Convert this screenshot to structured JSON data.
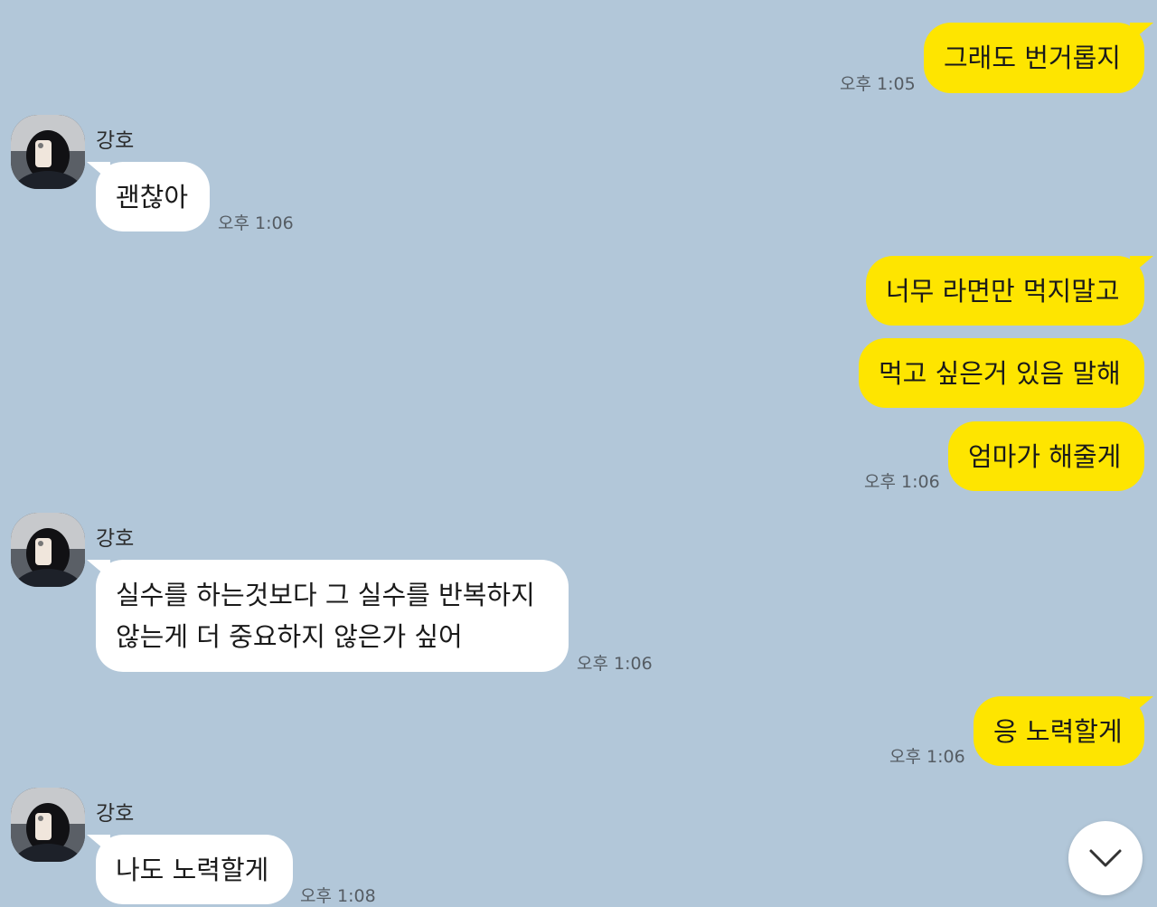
{
  "contact": {
    "name": "강호"
  },
  "messages": [
    {
      "from": "me",
      "text": "그래도 번거롭지",
      "time": "오후 1:05"
    },
    {
      "from": "them",
      "text": "괜찮아",
      "time": "오후 1:06"
    },
    {
      "from": "me",
      "text": "너무 라면만 먹지말고"
    },
    {
      "from": "me",
      "text": "먹고 싶은거 있음 말해"
    },
    {
      "from": "me",
      "text": "엄마가 해줄게",
      "time": "오후 1:06"
    },
    {
      "from": "them",
      "lines": [
        "실수를 하는것보다 그 실수를 반복하지",
        "않는게 더 중요하지 않은가 싶어"
      ],
      "time": "오후 1:06"
    },
    {
      "from": "me",
      "text": "응 노력할게",
      "time": "오후 1:06"
    },
    {
      "from": "them",
      "text": "나도 노력할게",
      "time": "오후 1:08"
    }
  ],
  "icons": {
    "scroll_down": "chevron-down-icon",
    "avatar": "profile-photo"
  },
  "colors": {
    "background": "#b2c7d9",
    "my_bubble": "#fee500",
    "their_bubble": "#ffffff"
  }
}
